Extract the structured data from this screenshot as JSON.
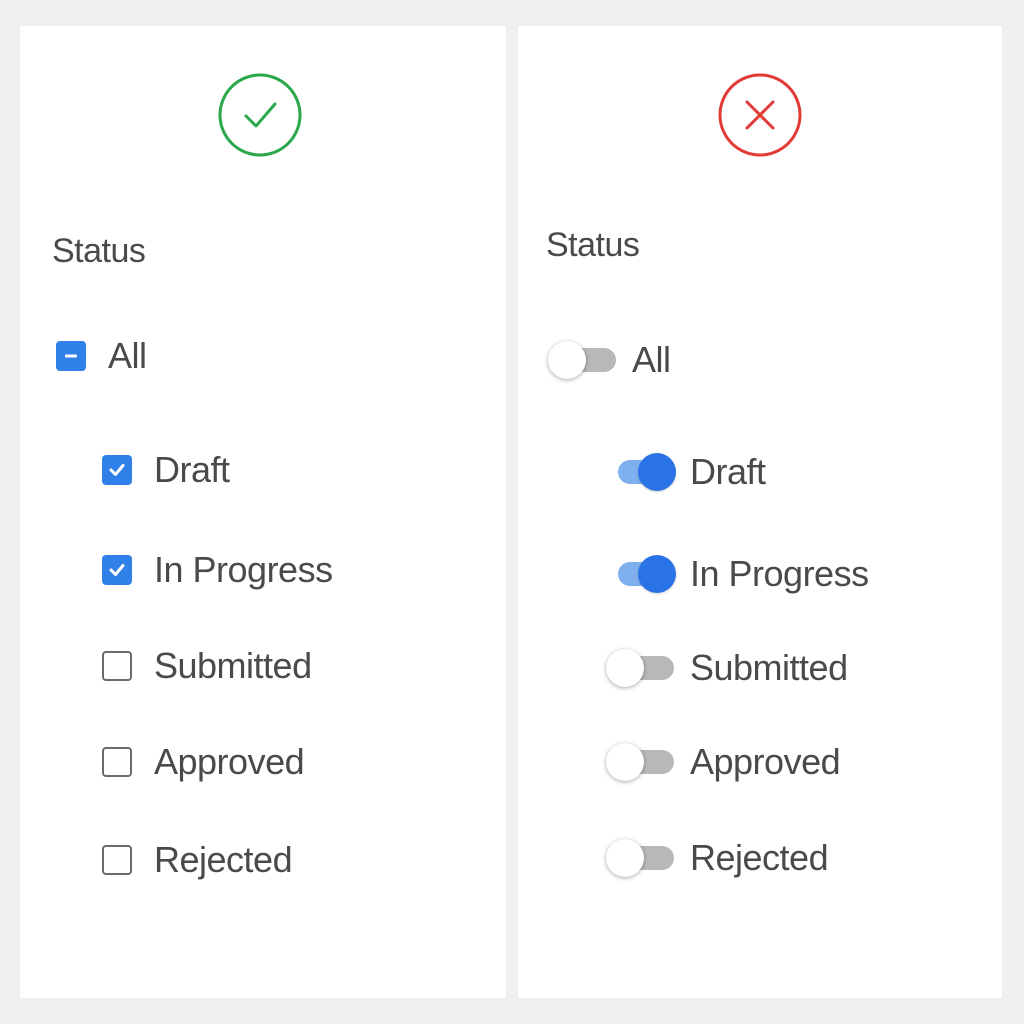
{
  "left_panel": {
    "verdict_icon": "check-circle-icon",
    "verdict_color": "#2aa84a",
    "title": "Status",
    "parent": {
      "label": "All",
      "state": "indeterminate"
    },
    "items": [
      {
        "label": "Draft",
        "checked": true
      },
      {
        "label": "In Progress",
        "checked": true
      },
      {
        "label": "Submitted",
        "checked": false
      },
      {
        "label": "Approved",
        "checked": false
      },
      {
        "label": "Rejected",
        "checked": false
      }
    ]
  },
  "right_panel": {
    "verdict_icon": "x-circle-icon",
    "verdict_color": "#e23b35",
    "title": "Status",
    "parent": {
      "label": "All",
      "on": false
    },
    "items": [
      {
        "label": "Draft",
        "on": true
      },
      {
        "label": "In Progress",
        "on": true
      },
      {
        "label": "Submitted",
        "on": false
      },
      {
        "label": "Approved",
        "on": false
      },
      {
        "label": "Rejected",
        "on": false
      }
    ]
  },
  "colors": {
    "accent": "#2f80e8",
    "toggle_on_track": "#7fb0ee",
    "toggle_on_thumb": "#2a73e6",
    "toggle_off_track": "#b8b8b8",
    "text": "#4a4a4a",
    "background": "#efefef"
  }
}
